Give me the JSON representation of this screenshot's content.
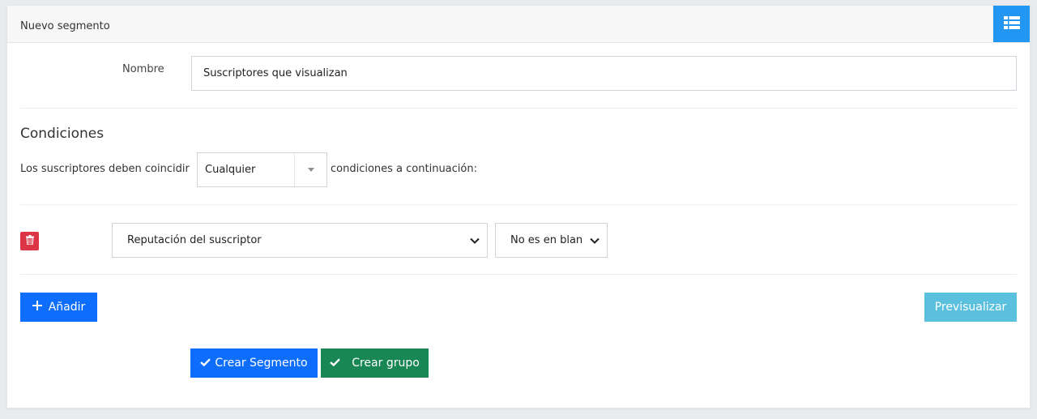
{
  "header": {
    "title": "Nuevo segmento",
    "action_icon": "list-icon"
  },
  "form": {
    "name_label": "Nombre",
    "name_value": "Suscriptores que visualizan"
  },
  "conditions": {
    "title": "Condiciones",
    "match_prefix": "Los suscriptores deben coincidir",
    "match_value": "Cualquier",
    "match_suffix": "condiciones a continuación:",
    "rows": [
      {
        "field": "Reputación del suscriptor",
        "operator": "No es en blan"
      }
    ]
  },
  "buttons": {
    "add": "Añadir",
    "preview": "Previsualizar",
    "create_segment": "Crear Segmento",
    "create_group": "Crear grupo"
  },
  "colors": {
    "header_button": "#2196f3",
    "primary": "#0d6efd",
    "info": "#5bc0de",
    "success": "#198754",
    "danger": "#dc3545"
  }
}
